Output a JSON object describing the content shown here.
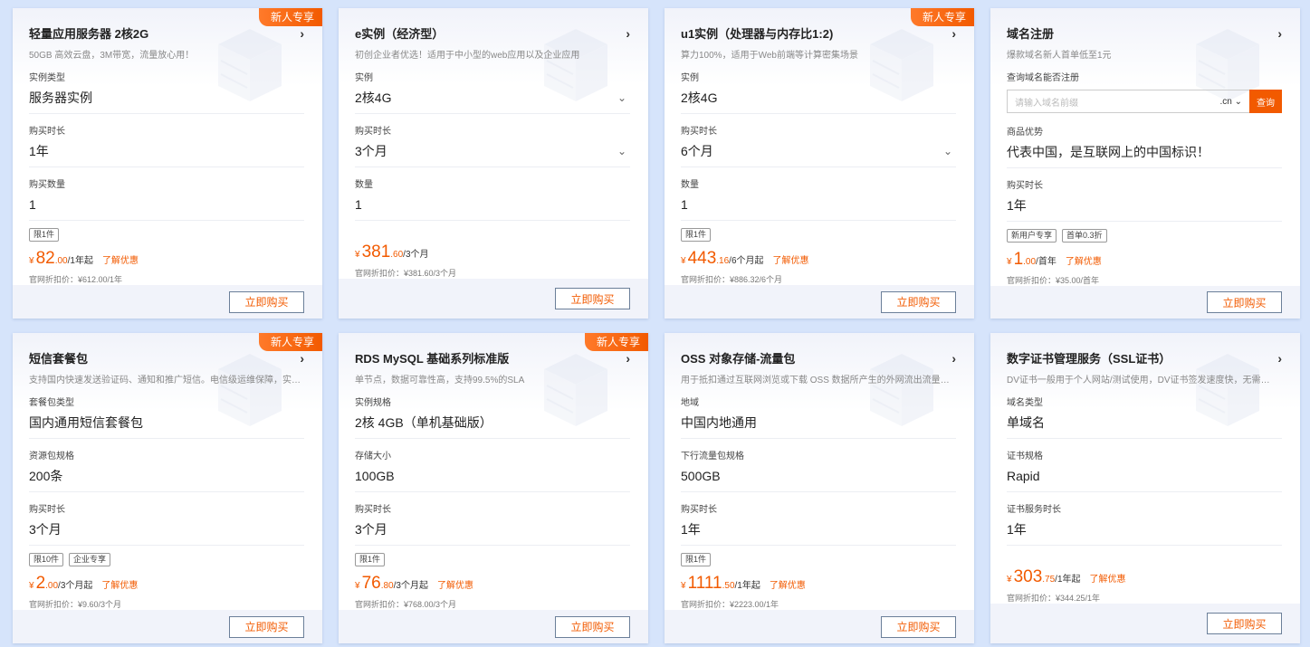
{
  "colors": {
    "accent": "#f25a00",
    "background": "#d6e4fb"
  },
  "icons": {
    "chevron": "chevron-right-icon",
    "dropdown": "chevron-down-icon"
  },
  "cards": [
    {
      "badge": "新人专享",
      "title": "轻量应用服务器 2核2G",
      "subtitle": "50GB 高效云盘，3M带宽，流量放心用！",
      "fields": [
        {
          "label": "实例类型",
          "value": "服务器实例"
        },
        {
          "label": "购买时长",
          "value": "1年"
        },
        {
          "label": "购买数量",
          "value": "1"
        }
      ],
      "tags": [
        "限1件"
      ],
      "price": {
        "symbol": "¥",
        "int": "82",
        "dec": ".00",
        "unit": "/1年起"
      },
      "promo": "了解优惠",
      "original": "官网折扣价：¥612.00/1年",
      "button": "立即购买"
    },
    {
      "badge": "",
      "title": "e实例（经济型）",
      "subtitle": "初创企业者优选！适用于中小型的web应用以及企业应用",
      "fields": [
        {
          "label": "实例",
          "value": "2核4G",
          "dropdown": true
        },
        {
          "label": "购买时长",
          "value": "3个月",
          "dropdown": true
        },
        {
          "label": "数量",
          "value": "1"
        }
      ],
      "tags": [],
      "price": {
        "symbol": "¥",
        "int": "381",
        "dec": ".60",
        "unit": "/3个月"
      },
      "promo": "",
      "original": "官网折扣价：¥381.60/3个月",
      "button": "立即购买"
    },
    {
      "badge": "新人专享",
      "title": "u1实例（处理器与内存比1:2)",
      "subtitle": "算力100%，适用于Web前端等计算密集场景",
      "fields": [
        {
          "label": "实例",
          "value": "2核4G"
        },
        {
          "label": "购买时长",
          "value": "6个月",
          "dropdown": true
        },
        {
          "label": "数量",
          "value": "1"
        }
      ],
      "tags": [
        "限1件"
      ],
      "price": {
        "symbol": "¥",
        "int": "443",
        "dec": ".16",
        "unit": "/6个月起"
      },
      "promo": "了解优惠",
      "original": "官网折扣价：¥886.32/6个月",
      "button": "立即购买"
    },
    {
      "badge": "",
      "title": "域名注册",
      "subtitle": "爆款域名新人首单低至1元",
      "domain": {
        "label": "查询域名能否注册",
        "placeholder": "请输入域名前缀",
        "suffix": ".cn",
        "button": "查询"
      },
      "fields": [
        {
          "label": "商品优势",
          "value": "代表中国，是互联网上的中国标识！"
        },
        {
          "label": "购买时长",
          "value": "1年"
        }
      ],
      "tags": [
        "新用户专享",
        "首单0.3折"
      ],
      "price": {
        "symbol": "¥",
        "int": "1",
        "dec": ".00",
        "unit": "/首年"
      },
      "promo": "了解优惠",
      "original": "官网折扣价：¥35.00/首年",
      "button": "立即购买"
    },
    {
      "badge": "新人专享",
      "title": "短信套餐包",
      "subtitle": "支持国内快速发送验证码、通知和推广短信。电信级运维保障，实时监控...",
      "fields": [
        {
          "label": "套餐包类型",
          "value": "国内通用短信套餐包"
        },
        {
          "label": "资源包规格",
          "value": "200条"
        },
        {
          "label": "购买时长",
          "value": "3个月"
        }
      ],
      "tags": [
        "限10件",
        "企业专享"
      ],
      "price": {
        "symbol": "¥",
        "int": "2",
        "dec": ".00",
        "unit": "/3个月起"
      },
      "promo": "了解优惠",
      "original": "官网折扣价：¥9.60/3个月",
      "button": "立即购买"
    },
    {
      "badge": "新人专享",
      "title": "RDS MySQL 基础系列标准版",
      "subtitle": "单节点，数据可靠性高，支持99.5%的SLA",
      "fields": [
        {
          "label": "实例规格",
          "value": "2核 4GB（单机基础版）"
        },
        {
          "label": "存储大小",
          "value": "100GB"
        },
        {
          "label": "购买时长",
          "value": "3个月"
        }
      ],
      "tags": [
        "限1件"
      ],
      "price": {
        "symbol": "¥",
        "int": "76",
        "dec": ".80",
        "unit": "/3个月起"
      },
      "promo": "了解优惠",
      "original": "官网折扣价：¥768.00/3个月",
      "button": "立即购买"
    },
    {
      "badge": "",
      "title": "OSS 对象存储-流量包",
      "subtitle": "用于抵扣通过互联网浏览或下载 OSS 数据所产生的外网流出流量费用",
      "fields": [
        {
          "label": "地域",
          "value": "中国内地通用"
        },
        {
          "label": "下行流量包规格",
          "value": "500GB"
        },
        {
          "label": "购买时长",
          "value": "1年"
        }
      ],
      "tags": [
        "限1件"
      ],
      "price": {
        "symbol": "¥",
        "int": "1111",
        "dec": ".50",
        "unit": "/1年起"
      },
      "promo": "了解优惠",
      "original": "官网折扣价：¥2223.00/1年",
      "button": "立即购买"
    },
    {
      "badge": "",
      "title": "数字证书管理服务（SSL证书）",
      "subtitle": "DV证书一般用于个人网站/测试使用，DV证书签发速度快，无需人工审核",
      "fields": [
        {
          "label": "域名类型",
          "value": "单域名"
        },
        {
          "label": "证书规格",
          "value": "Rapid"
        },
        {
          "label": "证书服务时长",
          "value": "1年"
        }
      ],
      "tags": [],
      "price": {
        "symbol": "¥",
        "int": "303",
        "dec": ".75",
        "unit": "/1年起"
      },
      "promo": "了解优惠",
      "original": "官网折扣价：¥344.25/1年",
      "button": "立即购买"
    }
  ]
}
